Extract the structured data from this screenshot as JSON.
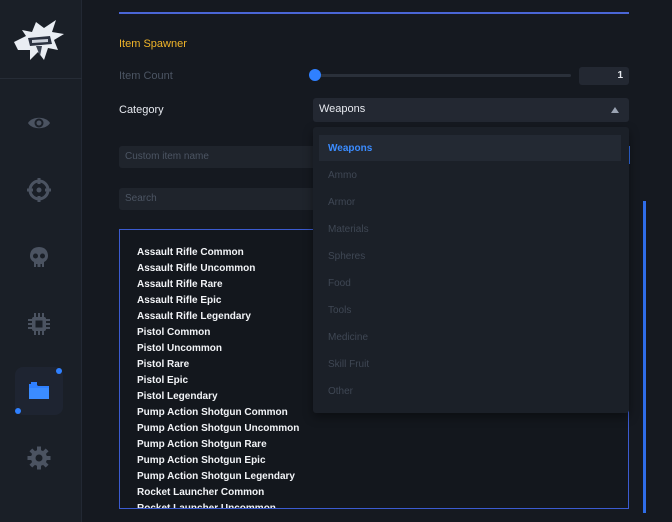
{
  "spawner": {
    "title": "Item Spawner",
    "item_count_label": "Item Count",
    "item_count_value": "1",
    "item_count_slider_fraction": 0.0,
    "category_label": "Category",
    "category_selected": "Weapons",
    "custom_name_placeholder": "Custom item name",
    "search_placeholder": "Search"
  },
  "dropdown": {
    "options": [
      "Weapons",
      "Ammo",
      "Armor",
      "Materials",
      "Spheres",
      "Food",
      "Tools",
      "Medicine",
      "Skill Fruit",
      "Other"
    ]
  },
  "items": [
    "Assault Rifle Common",
    "Assault Rifle Uncommon",
    "Assault Rifle Rare",
    "Assault Rifle Epic",
    "Assault Rifle Legendary",
    "Pistol Common",
    "Pistol Uncommon",
    "Pistol Rare",
    "Pistol Epic",
    "Pistol Legendary",
    "Pump Action Shotgun Common",
    "Pump Action Shotgun Uncommon",
    "Pump Action Shotgun Rare",
    "Pump Action Shotgun Epic",
    "Pump Action Shotgun Legendary",
    "Rocket Launcher Common",
    "Rocket Launcher Uncommon"
  ],
  "sidebar": {
    "items": [
      {
        "icon": "eye-icon"
      },
      {
        "icon": "crosshair-icon"
      },
      {
        "icon": "skull-icon"
      },
      {
        "icon": "chip-icon"
      },
      {
        "icon": "folder-icon"
      },
      {
        "icon": "gear-icon"
      }
    ],
    "active_index": 4
  },
  "colors": {
    "accent": "#2f80ff",
    "section_title": "#f0b429",
    "list_border": "#3b5bd0"
  }
}
